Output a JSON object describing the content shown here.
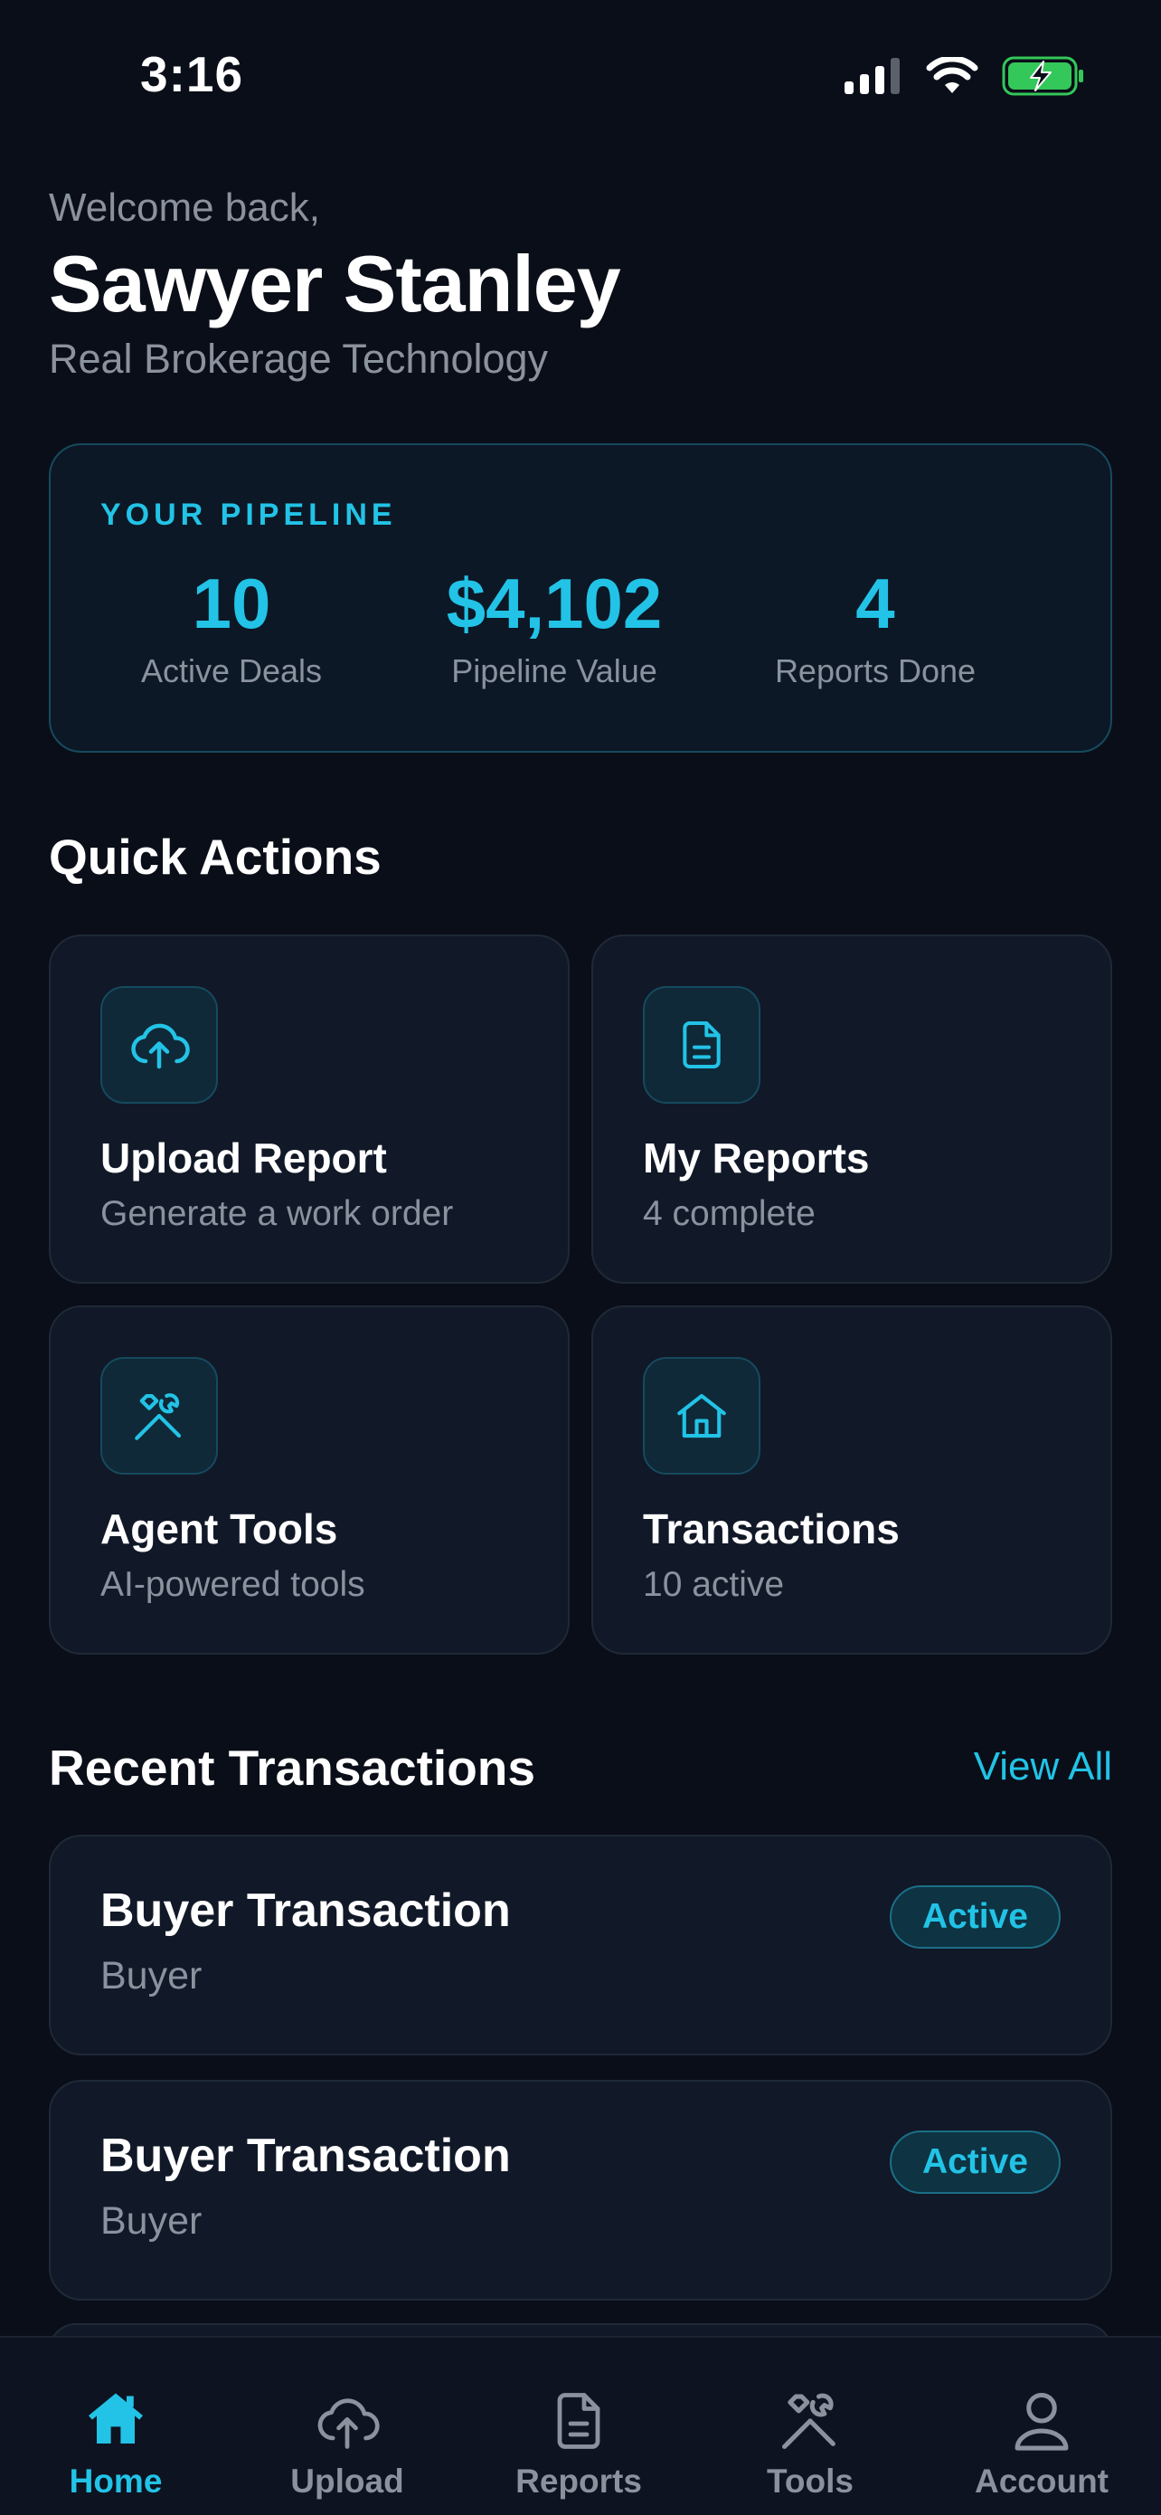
{
  "status_bar": {
    "time": "3:16"
  },
  "header": {
    "welcome": "Welcome back,",
    "name": "Sawyer Stanley",
    "company": "Real Brokerage Technology"
  },
  "pipeline": {
    "title": "YOUR PIPELINE",
    "stats": [
      {
        "value": "10",
        "label": "Active Deals"
      },
      {
        "value": "$4,102",
        "label": "Pipeline Value"
      },
      {
        "value": "4",
        "label": "Reports Done"
      }
    ]
  },
  "quick_actions": {
    "title": "Quick Actions",
    "items": [
      {
        "title": "Upload Report",
        "subtitle": "Generate a work order",
        "icon": "cloud-upload-icon"
      },
      {
        "title": "My Reports",
        "subtitle": "4 complete",
        "icon": "document-icon"
      },
      {
        "title": "Agent Tools",
        "subtitle": "AI-powered tools",
        "icon": "tools-icon"
      },
      {
        "title": "Transactions",
        "subtitle": "10 active",
        "icon": "house-icon"
      }
    ]
  },
  "recent_transactions": {
    "title": "Recent Transactions",
    "view_all": "View All",
    "items": [
      {
        "title": "Buyer Transaction",
        "subtitle": "Buyer",
        "status": "Active"
      },
      {
        "title": "Buyer Transaction",
        "subtitle": "Buyer",
        "status": "Active"
      }
    ]
  },
  "tab_bar": {
    "tabs": [
      {
        "label": "Home",
        "icon": "home-icon",
        "active": true
      },
      {
        "label": "Upload",
        "icon": "cloud-upload-icon",
        "active": false
      },
      {
        "label": "Reports",
        "icon": "document-icon",
        "active": false
      },
      {
        "label": "Tools",
        "icon": "tools-icon",
        "active": false
      },
      {
        "label": "Account",
        "icon": "person-icon",
        "active": false
      }
    ]
  },
  "colors": {
    "accent": "#22c3e6",
    "background": "#0a0e18",
    "card": "#111827",
    "muted_text": "#8a929e",
    "battery": "#34c759"
  }
}
